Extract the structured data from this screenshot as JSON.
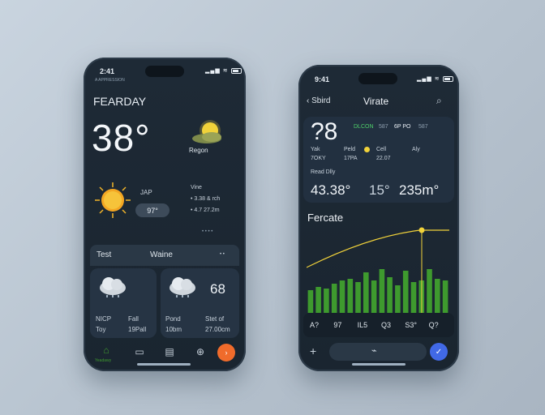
{
  "phone1": {
    "status_time": "2:41",
    "status_subtitle": "A APPRESSION",
    "title": "FEARDAY",
    "temperature": "38°",
    "condition_label": "Regon",
    "sun_label": "JAP",
    "sun_pill": "97°",
    "details_title": "Vine",
    "details_line1": "• 3.38 & rch",
    "details_line2": "• 4.7 27.2m",
    "dots": "• • • •",
    "section_left": "Test",
    "section_right": "Waine",
    "section_arrow": "• •",
    "card1": {
      "a": "NICP",
      "b": "Fall",
      "c": "Toy",
      "d": "19Pall"
    },
    "card2": {
      "value": "68",
      "a": "Pond",
      "b": "Stet of",
      "c": "10bm",
      "d": "27.00cm"
    },
    "nav_label": "Yeadawy"
  },
  "phone2": {
    "status_time": "9:41",
    "back_label": "Sbird",
    "title": "Virate",
    "big_number": "?8",
    "tags": [
      "DLCON",
      "587",
      "6P PO",
      "587"
    ],
    "col1_a": "Yak",
    "col1_b": "7OKY",
    "col2_a": "Peld",
    "col2_b": "17PA",
    "col3_a": "Cell",
    "col3_b": "22.07",
    "col4_a": "Aly",
    "caption": "Read Dlly",
    "value1": "43.38°",
    "value2": "15°",
    "value3": "235m°",
    "forecast_title": "Fercate",
    "x_labels": [
      "A?",
      "97",
      "IL5",
      "Q3",
      "S3°",
      "Q?"
    ]
  },
  "chart_data": {
    "type": "bar",
    "values": [
      28,
      32,
      30,
      36,
      40,
      42,
      38,
      50,
      40,
      54,
      44,
      34,
      52,
      38,
      40,
      54,
      42,
      40
    ]
  },
  "colors": {
    "accent_yellow": "#f1d23a",
    "accent_green": "#3e9a2e",
    "accent_orange": "#f06b2b",
    "accent_blue": "#4169e6"
  }
}
